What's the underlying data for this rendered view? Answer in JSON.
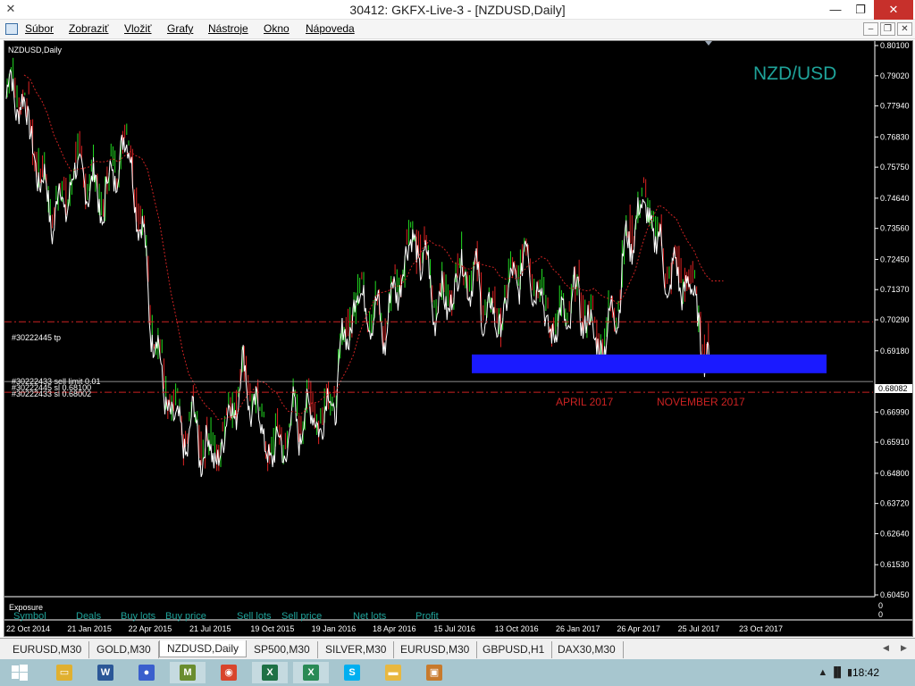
{
  "window": {
    "title": "30412: GKFX-Live-3 - [NZDUSD,Daily]",
    "minimize": "—",
    "restore": "❐",
    "close": "✕"
  },
  "menu": {
    "items": [
      "Súbor",
      "Zobraziť",
      "Vložiť",
      "Grafy",
      "Nástroje",
      "Okno",
      "Nápoveda"
    ],
    "mdi_minimize": "–",
    "mdi_restore": "❐",
    "mdi_close": "✕"
  },
  "chart": {
    "symbol_label": "NZDUSD,Daily",
    "watermark": "NZD/USD",
    "current_price": "0.68082",
    "tp_label": "#30222445 tp",
    "overlay_labels": [
      "#30222433 sell limit 0.01",
      "#30222445 sl 0.68100",
      "#30222433 sl 0.68002"
    ],
    "annotations": [
      "APRIL 2017",
      "NOVEMBER 2017"
    ],
    "exposure_title": "Exposure",
    "exposure_columns": [
      "Symbol",
      "Deals",
      "Buy lots",
      "Buy price",
      "Sell lots",
      "Sell price",
      "Net lots",
      "Profit"
    ],
    "exposure_values": [
      "0",
      "0"
    ],
    "colors": {
      "background": "#000000",
      "bull": "#22dd22",
      "bear": "#dd2222",
      "line": "#ffffff",
      "zone": "#1a1aff",
      "dashed": "#cc2222",
      "watermark": "#1fa39a"
    }
  },
  "chart_data": {
    "type": "line",
    "title": "",
    "price_axis": [
      "0.80100",
      "0.79020",
      "0.77940",
      "0.76830",
      "0.75750",
      "0.74640",
      "0.73560",
      "0.72450",
      "0.71370",
      "0.70290",
      "0.69180",
      "0.68082",
      "0.66990",
      "0.65910",
      "0.64800",
      "0.63720",
      "0.62640",
      "0.61530",
      "0.60450"
    ],
    "date_axis": [
      "22 Oct 2014",
      "21 Jan 2015",
      "22 Apr 2015",
      "21 Jul 2015",
      "19 Oct 2015",
      "19 Jan 2016",
      "18 Apr 2016",
      "15 Jul 2016",
      "13 Oct 2016",
      "26 Jan 2017",
      "26 Apr 2017",
      "25 Jul 2017",
      "23 Oct 2017"
    ],
    "ylim": [
      0.6045,
      0.801
    ],
    "series": [
      {
        "x": [
          "22 Oct 2014",
          "21 Jan 2015",
          "22 Apr 2015",
          "21 Jul 2015",
          "19 Oct 2015",
          "19 Jan 2016",
          "18 Apr 2016",
          "15 Jul 2016",
          "13 Oct 2016",
          "26 Jan 2017",
          "26 Apr 2017",
          "25 Jul 2017",
          "23 Oct 2017"
        ],
        "values": [
          0.785,
          0.745,
          0.765,
          0.655,
          0.675,
          0.66,
          0.705,
          0.725,
          0.712,
          0.718,
          0.698,
          0.745,
          0.688
        ]
      }
    ],
    "horizontal_levels": [
      {
        "label": "#30222445 tp",
        "value": 0.7022
      },
      {
        "value": 0.677
      }
    ],
    "zone": {
      "from": 0.6838,
      "to": 0.6905,
      "start": "13 Oct 2016",
      "end": "23 Oct 2017"
    }
  },
  "tabs": {
    "items": [
      "EURUSD,M30",
      "GOLD,M30",
      "NZDUSD,Daily",
      "SP500,M30",
      "SILVER,M30",
      "EURUSD,M30",
      "GBPUSD,H1",
      "DAX30,M30"
    ],
    "active_index": 2,
    "left_arrow": "◀",
    "right_arrow": "▶"
  },
  "taskbar": {
    "apps": [
      {
        "icon": "explorer-icon",
        "glyph": "▭",
        "color": "#e0b030"
      },
      {
        "icon": "word-icon",
        "glyph": "W",
        "color": "#2b5797"
      },
      {
        "icon": "app-icon",
        "glyph": "●",
        "color": "#3a5fcd"
      },
      {
        "icon": "metatrader-icon",
        "glyph": "M",
        "color": "#6a8d2f"
      },
      {
        "icon": "chrome-icon",
        "glyph": "◉",
        "color": "#d8452c"
      },
      {
        "icon": "excel-icon",
        "glyph": "X",
        "color": "#1e7145"
      },
      {
        "icon": "excel-alt-icon",
        "glyph": "X",
        "color": "#2a8a55"
      },
      {
        "icon": "skype-icon",
        "glyph": "S",
        "color": "#00aff0"
      },
      {
        "icon": "folder-icon",
        "glyph": "▬",
        "color": "#e8b840"
      },
      {
        "icon": "photos-icon",
        "glyph": "▣",
        "color": "#c87a2c"
      }
    ],
    "tray": "▲ ▐▌ ▮",
    "clock": "18:42"
  }
}
